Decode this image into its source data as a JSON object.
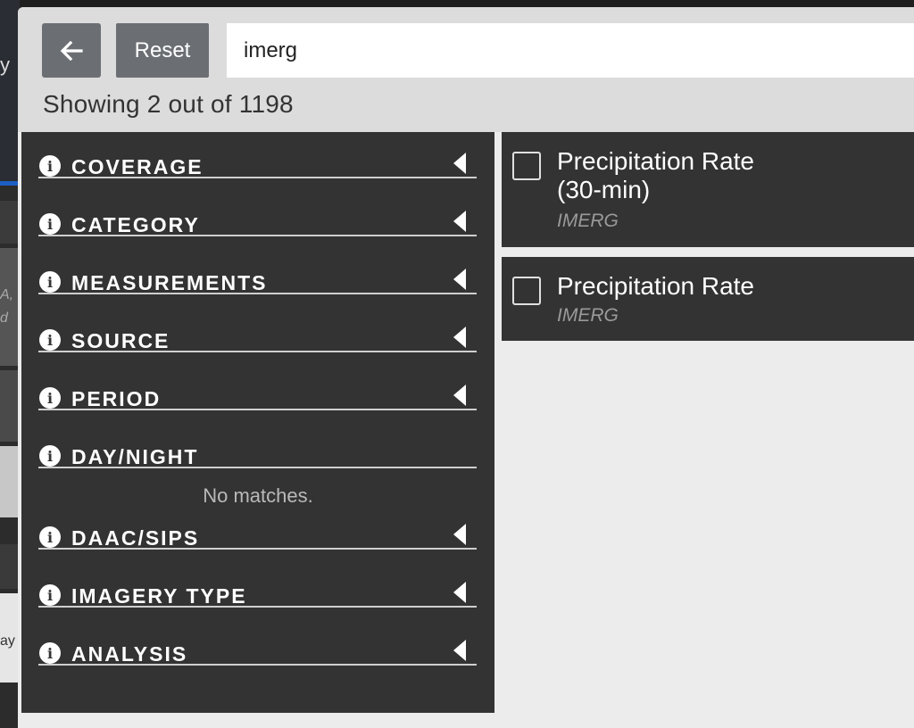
{
  "search": {
    "value": "imerg"
  },
  "header": {
    "reset_label": "Reset",
    "showing_text": "Showing 2 out of 1198"
  },
  "facets": [
    {
      "label": "COVERAGE",
      "expandable": true
    },
    {
      "label": "CATEGORY",
      "expandable": true
    },
    {
      "label": "MEASUREMENTS",
      "expandable": true
    },
    {
      "label": "SOURCE",
      "expandable": true
    },
    {
      "label": "PERIOD",
      "expandable": true
    },
    {
      "label": "DAY/NIGHT",
      "expandable": false,
      "empty_text": "No matches."
    },
    {
      "label": "DAAC/SIPS",
      "expandable": true
    },
    {
      "label": "IMAGERY TYPE",
      "expandable": true
    },
    {
      "label": "ANALYSIS",
      "expandable": true
    }
  ],
  "results": [
    {
      "title_line1": "Precipitation Rate",
      "title_line2": "(30-min)",
      "source": "IMERG",
      "checked": false
    },
    {
      "title_line1": "Precipitation Rate",
      "source": "IMERG",
      "checked": false
    }
  ],
  "background": {
    "left_text": [
      "y",
      "A,",
      "d",
      "ay"
    ]
  },
  "colors": {
    "panel": "#333333",
    "button": "#6b6f74",
    "header": "#dcdcdc",
    "body": "#ececec"
  },
  "icons": {
    "back": "arrow-left-icon",
    "info": "info-circle-icon",
    "caret": "caret-left-icon"
  }
}
